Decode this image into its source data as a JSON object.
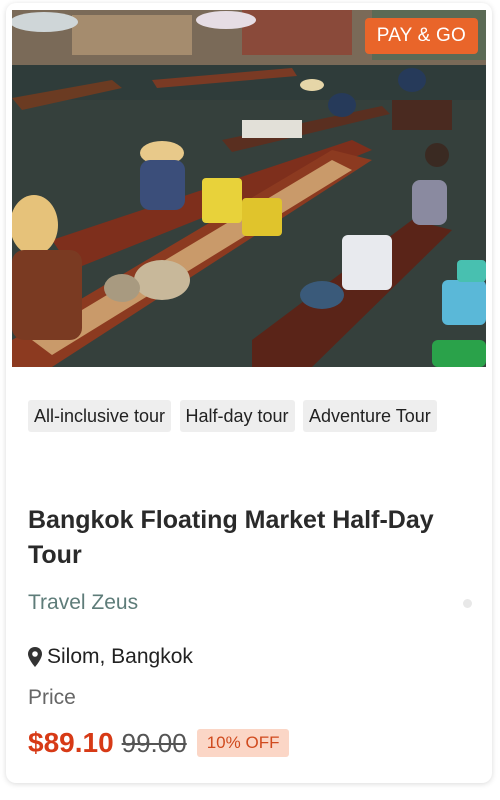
{
  "product": {
    "badge": "PAY & GO",
    "tags": [
      "All-inclusive tour",
      "Half-day tour",
      "Adventure Tour"
    ],
    "title": "Bangkok Floating Market Half-Day Tour",
    "vendor": "Travel Zeus",
    "location": "Silom, Bangkok",
    "price_label": "Price",
    "price": "$89.10",
    "original_price": "99.00",
    "discount": "10% OFF"
  },
  "colors": {
    "badge": "#e9652a",
    "price": "#d73a16",
    "vendor": "#5e7c79",
    "discount_bg": "#fbd6c6"
  },
  "icons": {
    "location": "map-pin-icon"
  }
}
